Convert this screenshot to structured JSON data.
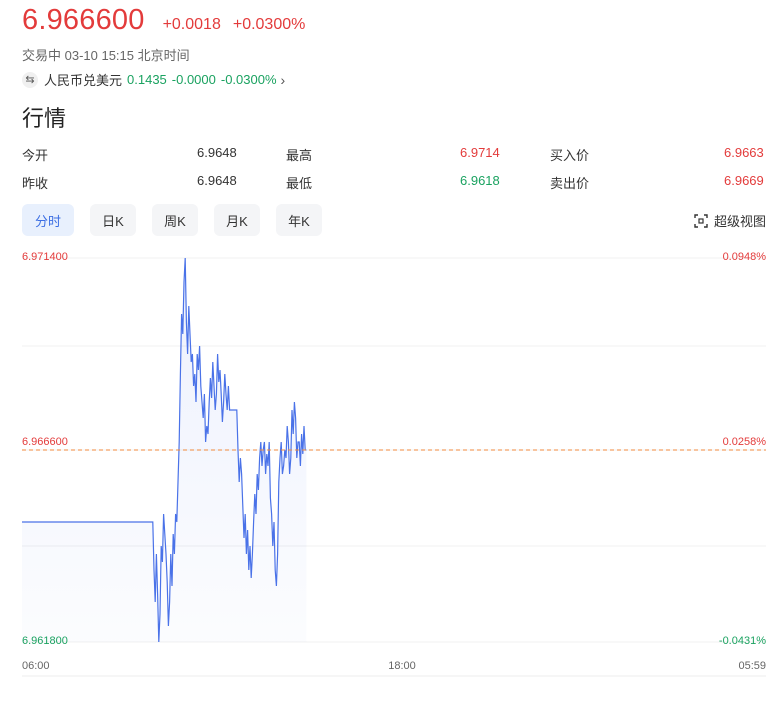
{
  "header": {
    "price": "6.966600",
    "change": "+0.0018",
    "change_pct": "+0.0300%",
    "status": "交易中 03-10 15:15 北京时间"
  },
  "related": {
    "name": "人民币兑美元",
    "value": "0.1435",
    "change": "-0.0000",
    "change_pct": "-0.0300%"
  },
  "section_title": "行情",
  "quote": {
    "open_label": "今开",
    "open_value": "6.9648",
    "high_label": "最高",
    "high_value": "6.9714",
    "bid_label": "买入价",
    "bid_value": "6.9663",
    "prev_close_label": "昨收",
    "prev_close_value": "6.9648",
    "low_label": "最低",
    "low_value": "6.9618",
    "ask_label": "卖出价",
    "ask_value": "6.9669"
  },
  "tabs": [
    "分时",
    "日K",
    "周K",
    "月K",
    "年K"
  ],
  "active_tab": 0,
  "super_view_label": "超级视图",
  "colors": {
    "up": "#e33b3b",
    "down": "#1aa260",
    "line": "#4a72e8",
    "accent": "#3d6fe3"
  },
  "chart_data": {
    "type": "line",
    "y_ticks_left": [
      "6.971400",
      "6.966600",
      "6.961800"
    ],
    "y_ticks_right": [
      "0.0948%",
      "0.0258%",
      "-0.0431%"
    ],
    "x_ticks": [
      "06:00",
      "18:00",
      "05:59"
    ],
    "ylim": [
      6.9618,
      6.9714
    ],
    "reference_price": 6.9666,
    "series": [
      {
        "values": [
          6.9648,
          6.9648,
          6.9648,
          6.9648,
          6.9648,
          6.9648,
          6.9648,
          6.9648,
          6.9648,
          6.9648,
          6.9648,
          6.9648,
          6.9648,
          6.9648,
          6.9648,
          6.9648,
          6.9648,
          6.9648,
          6.9648,
          6.9648,
          6.9648,
          6.9648,
          6.9648,
          6.9648,
          6.9648,
          6.9648,
          6.9648,
          6.9648,
          6.9648,
          6.9648,
          6.9648,
          6.9648,
          6.9648,
          6.9648,
          6.9648,
          6.9648,
          6.9648,
          6.9648,
          6.9648,
          6.9648,
          6.9648,
          6.9648,
          6.9648,
          6.9648,
          6.9648,
          6.9648,
          6.9648,
          6.9648,
          6.9648,
          6.9648,
          6.9648,
          6.9648,
          6.9648,
          6.9648,
          6.9648,
          6.9648,
          6.9648,
          6.9648,
          6.9648,
          6.9648,
          6.9648,
          6.9648,
          6.9648,
          6.9648,
          6.9648,
          6.9648,
          6.9648,
          6.9648,
          6.9648,
          6.9648,
          6.9648,
          6.9648,
          6.9648,
          6.9648,
          6.9648,
          6.9648,
          6.9648,
          6.9648,
          6.9648,
          6.9648,
          6.9648,
          6.9648,
          6.9648,
          6.9648,
          6.9648,
          6.9648,
          6.9648,
          6.9648,
          6.9648,
          6.9648,
          6.9648,
          6.9648,
          6.9648,
          6.9648,
          6.9648,
          6.9648,
          6.9648,
          6.9648,
          6.9648,
          6.9648,
          6.9648,
          6.9648,
          6.9648,
          6.9648,
          6.9648,
          6.9648,
          6.9648,
          6.9648,
          6.9648,
          6.9648,
          6.9636,
          6.9628,
          6.964,
          6.963,
          6.9618,
          6.9625,
          6.9642,
          6.9638,
          6.965,
          6.9645,
          6.964,
          6.9633,
          6.9622,
          6.9628,
          6.964,
          6.9632,
          6.9645,
          6.964,
          6.965,
          6.9648,
          6.9658,
          6.9668,
          6.9685,
          6.97,
          6.9695,
          6.9708,
          6.9714,
          6.9698,
          6.969,
          6.9702,
          6.9695,
          6.9688,
          6.969,
          6.9682,
          6.9685,
          6.9678,
          6.969,
          6.9686,
          6.9692,
          6.9682,
          6.9678,
          6.9674,
          6.968,
          6.9668,
          6.9672,
          6.967,
          6.9678,
          6.9684,
          6.9679,
          6.9688,
          6.9682,
          6.9676,
          6.968,
          6.969,
          6.9683,
          6.9686,
          6.968,
          6.9673,
          6.9678,
          6.9685,
          6.968,
          6.9676,
          6.9682,
          6.9676,
          6.9676,
          6.9676,
          6.9676,
          6.9676,
          6.9676,
          6.9676,
          6.9666,
          6.9658,
          6.9664,
          6.966,
          6.9652,
          6.9644,
          6.965,
          6.964,
          6.9646,
          6.9636,
          6.9642,
          6.9634,
          6.964,
          6.9648,
          6.9655,
          6.965,
          6.966,
          6.9656,
          6.9664,
          6.9668,
          6.9662,
          6.9666,
          6.9668,
          6.966,
          6.9665,
          6.9662,
          6.9668,
          6.9654,
          6.965,
          6.9642,
          6.9648,
          6.9636,
          6.9632,
          6.964,
          6.9658,
          6.9664,
          6.9668,
          6.966,
          6.9662,
          6.9666,
          6.9664,
          6.9672,
          6.9668,
          6.966,
          6.9664,
          6.9676,
          6.967,
          6.9678,
          6.9674,
          6.9664,
          6.9668,
          6.9668,
          6.9662,
          6.967,
          6.9665,
          6.9672,
          6.9666,
          6.9666
        ]
      }
    ]
  }
}
